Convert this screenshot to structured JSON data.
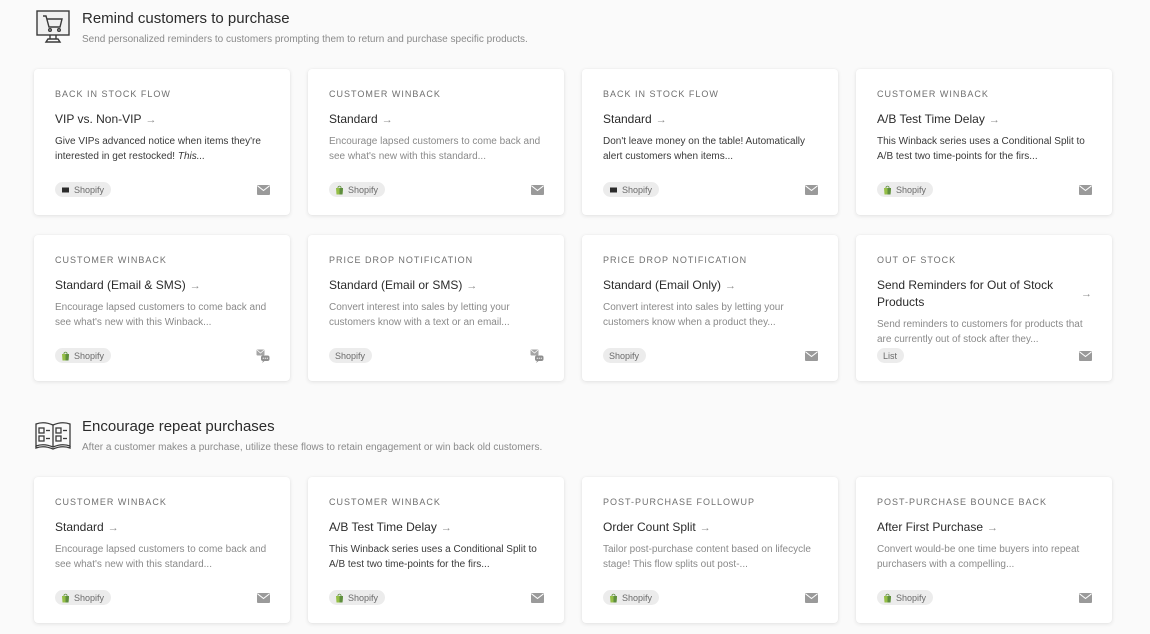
{
  "sections": [
    {
      "icon": "computer-cart-icon",
      "title": "Remind customers to purchase",
      "description": "Send personalized reminders to customers prompting them to return and purchase specific products.",
      "cards": [
        {
          "category": "Back in Stock Flow",
          "title": "VIP vs. Non-VIP",
          "description": "Give VIPs advanced notice when items they're interested in get restocked! This...",
          "desc_style": "dark",
          "tag": "Shopify",
          "tag_icon": "shopify-dark-icon",
          "channel": "email-icon"
        },
        {
          "category": "Customer Winback",
          "title": "Standard",
          "description": "Encourage lapsed customers to come back and see what's new with this standard...",
          "desc_style": "light",
          "tag": "Shopify",
          "tag_icon": "shopify-bag-icon",
          "channel": "email-icon"
        },
        {
          "category": "Back in Stock Flow",
          "title": "Standard",
          "description": "Don't leave money on the table! Automatically alert customers when items...",
          "desc_style": "dark",
          "tag": "Shopify",
          "tag_icon": "shopify-dark-icon",
          "channel": "email-icon"
        },
        {
          "category": "Customer Winback",
          "title": "A/B Test Time Delay",
          "description": "This Winback series uses a Conditional Split to A/B test two time-points for the firs...",
          "desc_style": "dark",
          "tag": "Shopify",
          "tag_icon": "shopify-bag-icon",
          "channel": "email-icon"
        },
        {
          "category": "Customer Winback",
          "title": "Standard (Email & SMS)",
          "description": "Encourage lapsed customers to come back and see what's new with this Winback...",
          "desc_style": "light",
          "tag": "Shopify",
          "tag_icon": "shopify-bag-icon",
          "channel": "email-sms-icon"
        },
        {
          "category": "Price Drop Notification",
          "title": "Standard (Email or SMS)",
          "description": "Convert interest into sales by letting your customers know with a text or an email...",
          "desc_style": "light",
          "tag": "Shopify",
          "tag_icon": "",
          "channel": "email-sms-icon"
        },
        {
          "category": "Price Drop Notification",
          "title": "Standard (Email Only)",
          "description": "Convert interest into sales by letting your customers know when a product they...",
          "desc_style": "light",
          "tag": "Shopify",
          "tag_icon": "",
          "channel": "email-icon"
        },
        {
          "category": "Out of Stock",
          "title": "Send Reminders for Out of Stock Products",
          "description": "Send reminders to customers for products that are currently out of stock after they...",
          "desc_style": "light",
          "tag": "List",
          "tag_icon": "",
          "channel": "email-icon"
        }
      ]
    },
    {
      "icon": "open-book-icon",
      "title": "Encourage repeat purchases",
      "description": "After a customer makes a purchase, utilize these flows to retain engagement or win back old customers.",
      "cards": [
        {
          "category": "Customer Winback",
          "title": "Standard",
          "description": "Encourage lapsed customers to come back and see what's new with this standard...",
          "desc_style": "light",
          "tag": "Shopify",
          "tag_icon": "shopify-bag-icon",
          "channel": "email-icon"
        },
        {
          "category": "Customer Winback",
          "title": "A/B Test Time Delay",
          "description": "This Winback series uses a Conditional Split to A/B test two time-points for the firs...",
          "desc_style": "dark",
          "tag": "Shopify",
          "tag_icon": "shopify-bag-icon",
          "channel": "email-icon"
        },
        {
          "category": "Post-Purchase Followup",
          "title": "Order Count Split",
          "description": "Tailor post-purchase content based on lifecycle stage! This flow splits out post-...",
          "desc_style": "light",
          "tag": "Shopify",
          "tag_icon": "shopify-bag-icon",
          "channel": "email-icon"
        },
        {
          "category": "Post-Purchase Bounce Back",
          "title": "After First Purchase",
          "description": "Convert would-be one time buyers into repeat purchasers with a compelling...",
          "desc_style": "light",
          "tag": "Shopify",
          "tag_icon": "shopify-bag-icon",
          "channel": "email-icon"
        }
      ]
    }
  ],
  "colors": {
    "shopify_green": "#95bf47",
    "icon_gray": "#9a9a9a",
    "tag_bg": "#ececec"
  }
}
